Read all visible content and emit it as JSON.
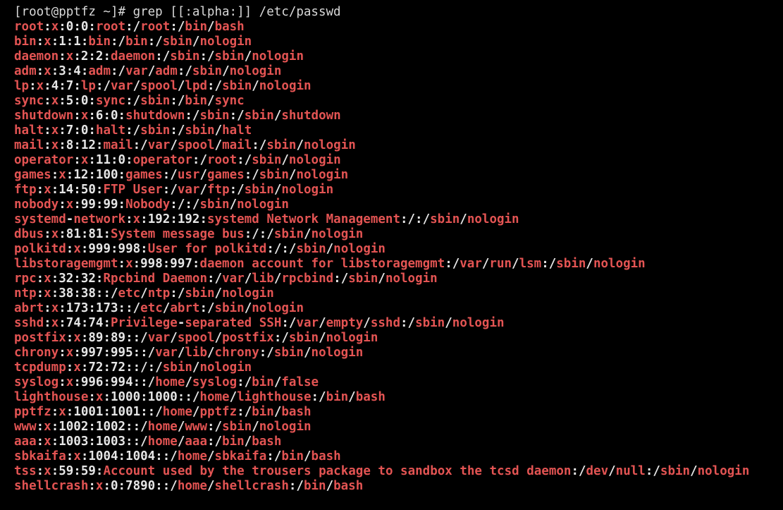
{
  "terminal": {
    "background_color": "#000000",
    "plain_text_color": "#e6e6e6",
    "match_text_color": "#e35453",
    "prompt_text_color": "#d9d9d9",
    "prompt": {
      "user_host": "[root@pptfz ~]#",
      "command": "grep [[:alpha:]] /etc/passwd",
      "full_line": "[root@pptfz ~]# grep [[:alpha:]] /etc/passwd"
    },
    "output_lines": [
      "root:x:0:0:root:/root:/bin/bash",
      "bin:x:1:1:bin:/bin:/sbin/nologin",
      "daemon:x:2:2:daemon:/sbin:/sbin/nologin",
      "adm:x:3:4:adm:/var/adm:/sbin/nologin",
      "lp:x:4:7:lp:/var/spool/lpd:/sbin/nologin",
      "sync:x:5:0:sync:/sbin:/bin/sync",
      "shutdown:x:6:0:shutdown:/sbin:/sbin/shutdown",
      "halt:x:7:0:halt:/sbin:/sbin/halt",
      "mail:x:8:12:mail:/var/spool/mail:/sbin/nologin",
      "operator:x:11:0:operator:/root:/sbin/nologin",
      "games:x:12:100:games:/usr/games:/sbin/nologin",
      "ftp:x:14:50:FTP User:/var/ftp:/sbin/nologin",
      "nobody:x:99:99:Nobody:/:/sbin/nologin",
      "systemd-network:x:192:192:systemd Network Management:/:/sbin/nologin",
      "dbus:x:81:81:System message bus:/:/sbin/nologin",
      "polkitd:x:999:998:User for polkitd:/:/sbin/nologin",
      "libstoragemgmt:x:998:997:daemon account for libstoragemgmt:/var/run/lsm:/sbin/nologin",
      "rpc:x:32:32:Rpcbind Daemon:/var/lib/rpcbind:/sbin/nologin",
      "ntp:x:38:38::/etc/ntp:/sbin/nologin",
      "abrt:x:173:173::/etc/abrt:/sbin/nologin",
      "sshd:x:74:74:Privilege-separated SSH:/var/empty/sshd:/sbin/nologin",
      "postfix:x:89:89::/var/spool/postfix:/sbin/nologin",
      "chrony:x:997:995::/var/lib/chrony:/sbin/nologin",
      "tcpdump:x:72:72::/:/sbin/nologin",
      "syslog:x:996:994::/home/syslog:/bin/false",
      "lighthouse:x:1000:1000::/home/lighthouse:/bin/bash",
      "pptfz:x:1001:1001::/home/pptfz:/bin/bash",
      "www:x:1002:1002::/home/www:/sbin/nologin",
      "aaa:x:1003:1003::/home/aaa:/bin/bash",
      "sbkaifa:x:1004:1004::/home/sbkaifa:/bin/bash",
      "tss:x:59:59:Account used by the trousers package to sandbox the tcsd daemon:/dev/null:/sbin/nologin",
      "shellcrash:x:0:7890::/home/shellcrash:/bin/bash"
    ]
  }
}
